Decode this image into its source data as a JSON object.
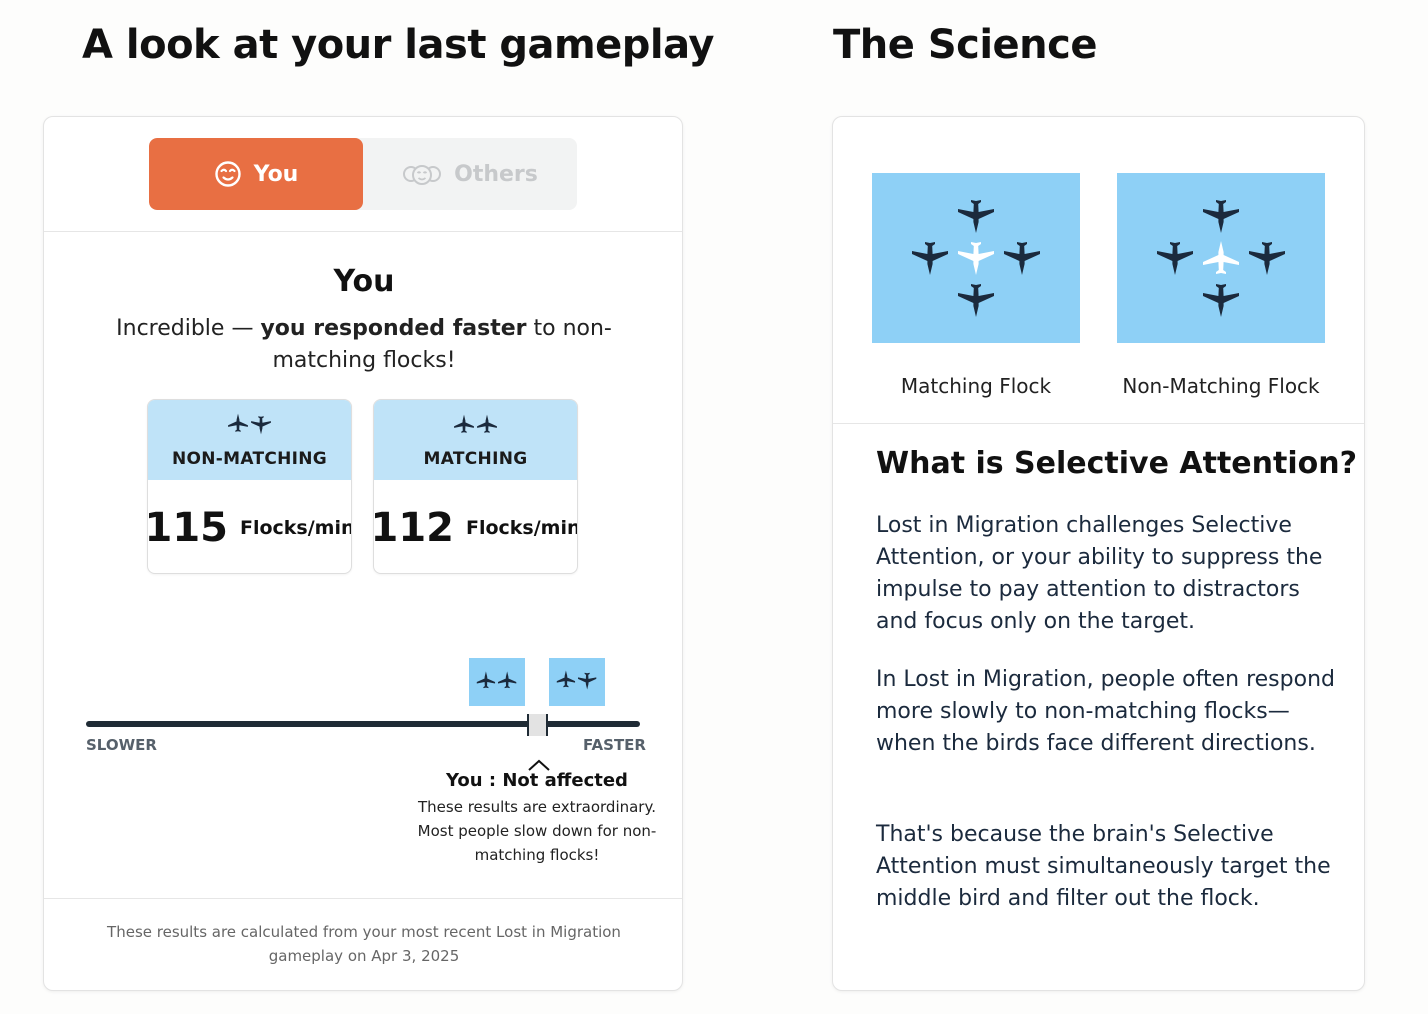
{
  "headings": {
    "left": "A look at your last gameplay",
    "right": "The Science"
  },
  "toggle": {
    "you_label": "You",
    "others_label": "Others",
    "you_icon": "face-icon",
    "others_icon": "group-faces-icon",
    "active": "You",
    "active_color": "#e86f43"
  },
  "result": {
    "title": "You",
    "message_prefix": "Incredible — ",
    "message_bold": "you responded faster",
    "message_suffix": " to non-matching flocks!"
  },
  "stats": [
    {
      "label": "NON-MATCHING",
      "value": "115",
      "unit": "Flocks/min",
      "icon": "non-matching-birds-icon"
    },
    {
      "label": "MATCHING",
      "value": "112",
      "unit": "Flocks/min",
      "icon": "matching-birds-icon"
    }
  ],
  "scale": {
    "slower_label": "SLOWER",
    "faster_label": "FASTER",
    "you_label": "You : Not affected",
    "description": "These results are extraordinary. Most people slow down for non-matching flocks!"
  },
  "footer": {
    "note": "These results are calculated from your most recent Lost in Migration gameplay on Apr 3, 2025"
  },
  "science": {
    "flock_labels": [
      "Matching Flock",
      "Non-Matching Flock"
    ],
    "title": "What is Selective Attention?",
    "paragraphs": [
      "Lost in Migration challenges Selective Attention, or your ability to suppress the impulse to pay attention to distractors and focus only on the target.",
      "In Lost in Migration, people often respond more slowly to non-matching flocks—when the birds face different directions.",
      "That's because the brain's Selective Attention must simultaneously target the middle bird and filter out the flock."
    ]
  },
  "colors": {
    "accent": "#e86f43",
    "light_blue": "#bfe3f8",
    "sky_blue": "#8ed0f6",
    "dark_navy": "#1f2b35"
  }
}
